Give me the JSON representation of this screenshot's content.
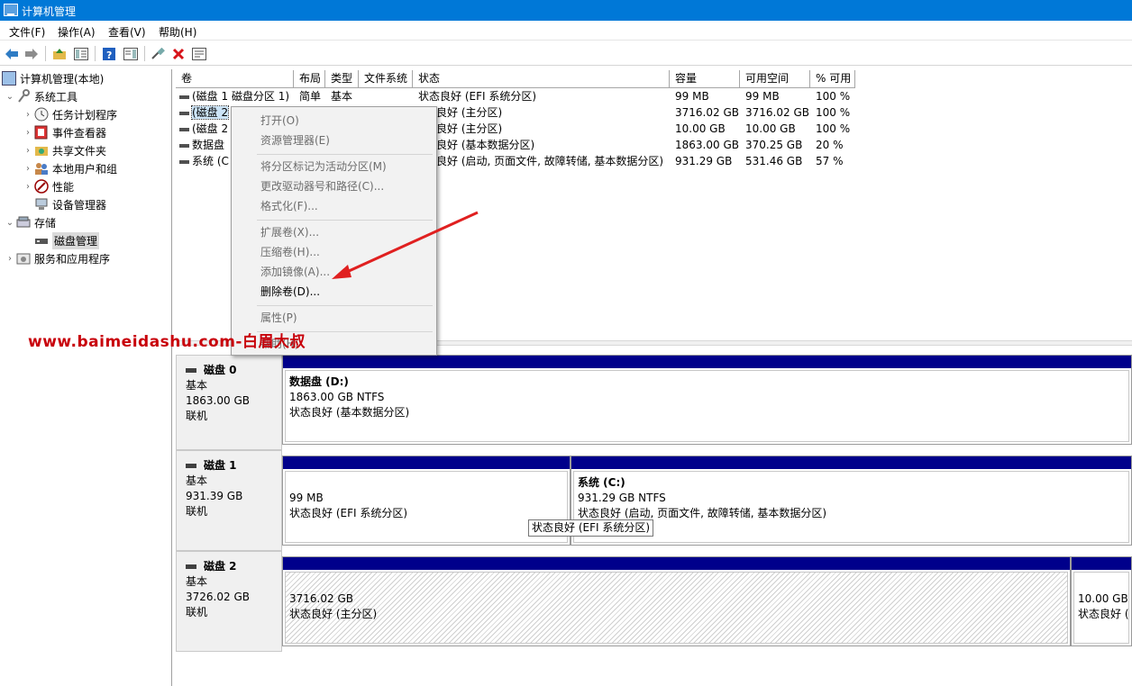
{
  "window": {
    "title": "计算机管理"
  },
  "menu": [
    "文件(F)",
    "操作(A)",
    "查看(V)",
    "帮助(H)"
  ],
  "toolbar": {
    "icons": [
      "back-arrow-icon",
      "forward-arrow-icon",
      "up-folder-icon",
      "show-hide-tree-icon",
      "help-icon",
      "show-action-pane-icon",
      "connect-icon",
      "delete-icon",
      "properties-icon"
    ],
    "accent": "#0078d7"
  },
  "tree": {
    "root": "计算机管理(本地)",
    "system_tools": "系统工具",
    "task_scheduler": "任务计划程序",
    "event_viewer": "事件查看器",
    "shared_folders": "共享文件夹",
    "local_users": "本地用户和组",
    "performance": "性能",
    "device_manager": "设备管理器",
    "storage": "存储",
    "disk_management": "磁盘管理",
    "services": "服务和应用程序"
  },
  "volume_list": {
    "headers": [
      "卷",
      "布局",
      "类型",
      "文件系统",
      "状态",
      "容量",
      "可用空间",
      "% 可用"
    ],
    "rows": [
      {
        "volume": "(磁盘 1 磁盘分区 1)",
        "layout": "简单",
        "type": "基本",
        "fs": "",
        "status": "状态良好 (EFI 系统分区)",
        "capacity": "99 MB",
        "free": "99 MB",
        "pct": "100 %"
      },
      {
        "volume": "(磁盘 2",
        "layout": "",
        "type": "",
        "fs": "",
        "status": "态良好 (主分区)",
        "capacity": "3716.02 GB",
        "free": "3716.02 GB",
        "pct": "100 %"
      },
      {
        "volume": "(磁盘 2",
        "layout": "",
        "type": "",
        "fs": "",
        "status": "态良好 (主分区)",
        "capacity": "10.00 GB",
        "free": "10.00 GB",
        "pct": "100 %"
      },
      {
        "volume": "数据盘",
        "layout": "",
        "type": "",
        "fs": "",
        "status": "态良好 (基本数据分区)",
        "capacity": "1863.00 GB",
        "free": "370.25 GB",
        "pct": "20 %"
      },
      {
        "volume": "系统 (C",
        "layout": "",
        "type": "",
        "fs": "",
        "status": "态良好 (启动, 页面文件, 故障转储, 基本数据分区)",
        "capacity": "931.29 GB",
        "free": "531.46 GB",
        "pct": "57 %"
      }
    ]
  },
  "context_menu": {
    "open": "打开(O)",
    "explorer": "资源管理器(E)",
    "mark_active": "将分区标记为活动分区(M)",
    "change_letter": "更改驱动器号和路径(C)...",
    "format": "格式化(F)...",
    "extend": "扩展卷(X)...",
    "shrink": "压缩卷(H)...",
    "mirror": "添加镜像(A)...",
    "delete": "删除卷(D)...",
    "properties": "属性(P)",
    "help": "帮助(H)"
  },
  "disks": [
    {
      "name": "磁盘 0",
      "type": "基本",
      "size": "1863.00 GB",
      "state": "联机",
      "partitions": [
        {
          "name": "数据盘  (D:)",
          "size": "1863.00 GB NTFS",
          "status": "状态良好 (基本数据分区)"
        }
      ]
    },
    {
      "name": "磁盘 1",
      "type": "基本",
      "size": "931.39 GB",
      "state": "联机",
      "partitions": [
        {
          "name": "",
          "size": "99 MB",
          "status": "状态良好 (EFI 系统分区)"
        },
        {
          "name": "系统  (C:)",
          "size": "931.29 GB NTFS",
          "status": "状态良好 (启动, 页面文件, 故障转储, 基本数据分区)"
        }
      ]
    },
    {
      "name": "磁盘 2",
      "type": "基本",
      "size": "3726.02 GB",
      "state": "联机",
      "partitions": [
        {
          "name": "",
          "size": "3716.02 GB",
          "status": "状态良好 (主分区)"
        },
        {
          "name": "",
          "size": "10.00 GB",
          "status": "状态良好 (主"
        }
      ]
    }
  ],
  "tooltip": "状态良好 (EFI 系统分区)",
  "watermark": "www.baimeidashu.com-白眉大叔"
}
